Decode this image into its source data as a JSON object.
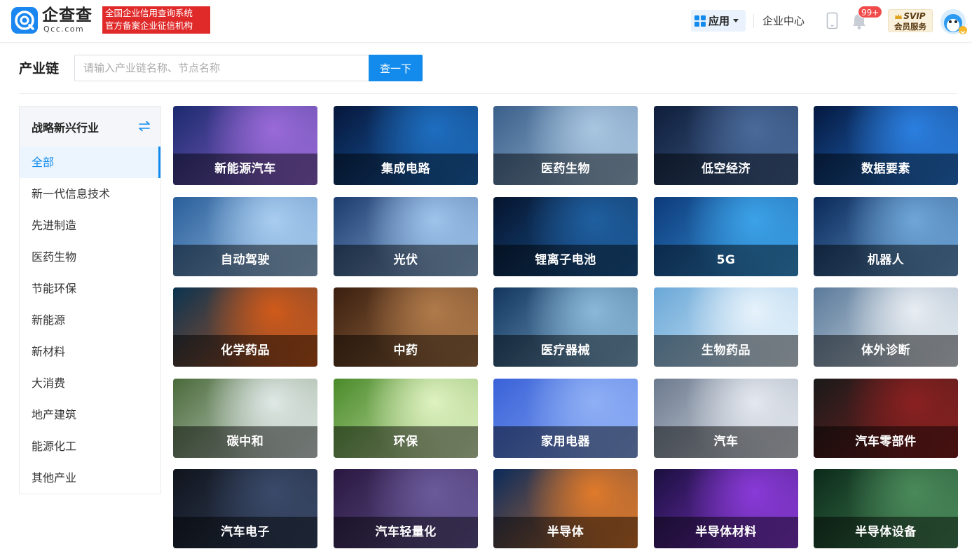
{
  "header": {
    "logo_name": "企查查",
    "logo_sub": "Qcc.com",
    "slogan_line1": "全国企业信用查询系统",
    "slogan_line2": "官方备案企业征信机构",
    "app_label": "应用",
    "enterprise_center": "企业中心",
    "notification_count": "99+",
    "svip_line1": "SVIP",
    "svip_line2": "会员服务"
  },
  "page": {
    "title": "产业链",
    "search_placeholder": "请输入产业链名称、节点名称",
    "search_button": "查一下"
  },
  "sidebar": {
    "heading": "战略新兴行业",
    "items": [
      {
        "label": "全部",
        "active": true
      },
      {
        "label": "新一代信息技术"
      },
      {
        "label": "先进制造"
      },
      {
        "label": "医药生物"
      },
      {
        "label": "节能环保"
      },
      {
        "label": "新能源"
      },
      {
        "label": "新材料"
      },
      {
        "label": "大消费"
      },
      {
        "label": "地产建筑"
      },
      {
        "label": "能源化工"
      },
      {
        "label": "其他产业"
      }
    ]
  },
  "cards": [
    {
      "label": "新能源汽车",
      "name": "card-new-energy-vehicle",
      "c1": "#1b2a6e",
      "c2": "#9a6ad8"
    },
    {
      "label": "集成电路",
      "name": "card-integrated-circuit",
      "c1": "#06163a",
      "c2": "#1e6ec0"
    },
    {
      "label": "医药生物",
      "name": "card-biomedicine",
      "c1": "#3a5f8a",
      "c2": "#a9c6e0"
    },
    {
      "label": "低空经济",
      "name": "card-low-altitude-economy",
      "c1": "#0e1d3a",
      "c2": "#4a6a9a"
    },
    {
      "label": "数据要素",
      "name": "card-data-elements",
      "c1": "#04183f",
      "c2": "#2b7fe0"
    },
    {
      "label": "自动驾驶",
      "name": "card-autonomous-driving",
      "c1": "#2a5f9a",
      "c2": "#a9cdf0"
    },
    {
      "label": "光伏",
      "name": "card-photovoltaic",
      "c1": "#1c3b6e",
      "c2": "#9ec4ec"
    },
    {
      "label": "锂离子电池",
      "name": "card-lithium-battery",
      "c1": "#05142e",
      "c2": "#1f5fa0"
    },
    {
      "label": "5G",
      "name": "card-5g",
      "c1": "#0d3a7a",
      "c2": "#3ca2e8"
    },
    {
      "label": "机器人",
      "name": "card-robot",
      "c1": "#0a2a5a",
      "c2": "#6fa6d8"
    },
    {
      "label": "化学药品",
      "name": "card-chemical-drugs",
      "c1": "#0b3350",
      "c2": "#d05a1a"
    },
    {
      "label": "中药",
      "name": "card-tcm",
      "c1": "#3a1f10",
      "c2": "#b07a4a"
    },
    {
      "label": "医疗器械",
      "name": "card-medical-devices",
      "c1": "#12355e",
      "c2": "#8ab8d8"
    },
    {
      "label": "生物药品",
      "name": "card-bio-drugs",
      "c1": "#6aa8d8",
      "c2": "#e6f2fb"
    },
    {
      "label": "体外诊断",
      "name": "card-ivd",
      "c1": "#5a7a9a",
      "c2": "#e8edf2"
    },
    {
      "label": "碳中和",
      "name": "card-carbon-neutral",
      "c1": "#4a6a3a",
      "c2": "#dfe8e6"
    },
    {
      "label": "环保",
      "name": "card-environmental",
      "c1": "#4a8a2a",
      "c2": "#dff2c0"
    },
    {
      "label": "家用电器",
      "name": "card-home-appliances",
      "c1": "#3a62d8",
      "c2": "#8fb0f5"
    },
    {
      "label": "汽车",
      "name": "card-automobile",
      "c1": "#6c7a8e",
      "c2": "#e4e8ef"
    },
    {
      "label": "汽车零部件",
      "name": "card-auto-parts",
      "c1": "#1a1a1a",
      "c2": "#8a2020"
    },
    {
      "label": "汽车电子",
      "name": "card-auto-electronics",
      "c1": "#10141c",
      "c2": "#3a4a6a"
    },
    {
      "label": "汽车轻量化",
      "name": "card-auto-lightweight",
      "c1": "#2a1740",
      "c2": "#6a5a9a"
    },
    {
      "label": "半导体",
      "name": "card-semiconductor",
      "c1": "#0a2a5a",
      "c2": "#e07a2a"
    },
    {
      "label": "半导体材料",
      "name": "card-semiconductor-materials",
      "c1": "#1a0f3e",
      "c2": "#8a3ad8"
    },
    {
      "label": "半导体设备",
      "name": "card-semiconductor-equipment",
      "c1": "#0b2a1a",
      "c2": "#4a8a5a"
    }
  ]
}
